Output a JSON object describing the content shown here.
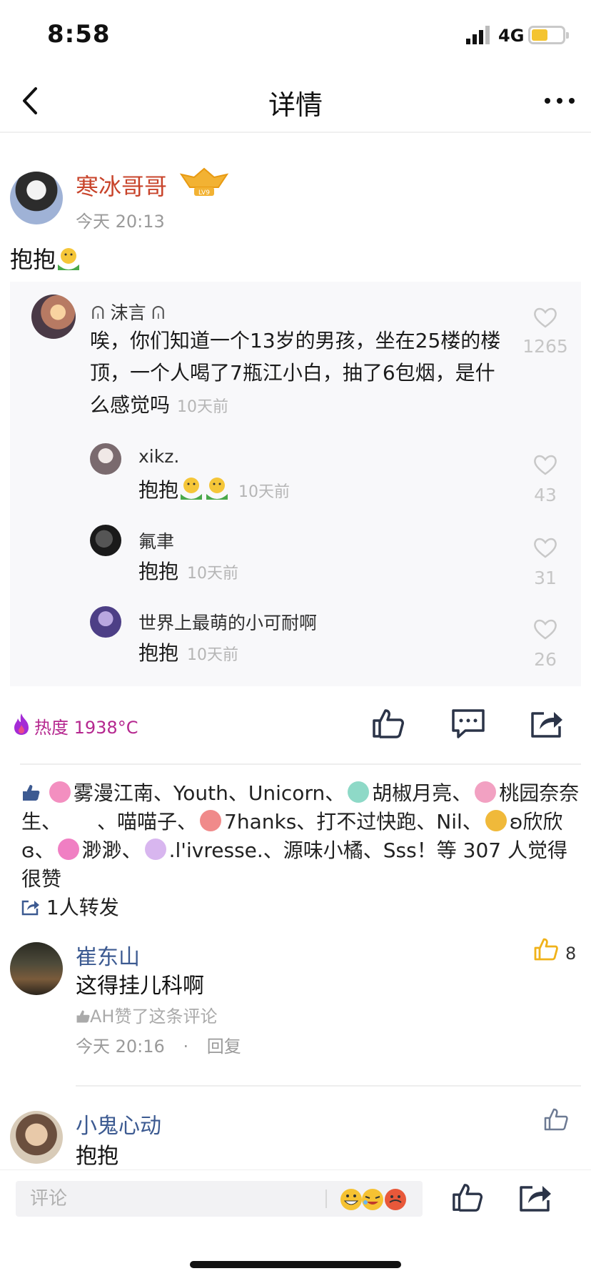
{
  "status_bar": {
    "time": "8:58",
    "network": "4G"
  },
  "nav": {
    "title": "详情"
  },
  "post": {
    "author": "寒冰哥哥",
    "level": "LV9",
    "time": "今天 20:13",
    "text": "抱抱"
  },
  "quoted": {
    "name": "沫言",
    "text": "唉，你们知道一个13岁的男孩，坐在25楼的楼顶，一个人喝了7瓶江小白，抽了6包烟，是什么感觉吗",
    "ago": "10天前",
    "likes": "1265",
    "replies": [
      {
        "name": "xikz.",
        "text": "抱抱",
        "ago": "10天前",
        "likes": "43"
      },
      {
        "name": "氟聿",
        "text": "抱抱",
        "ago": "10天前",
        "likes": "31"
      },
      {
        "name": "世界上最萌的小可耐啊",
        "text": "抱抱",
        "ago": "10天前",
        "likes": "26"
      }
    ]
  },
  "heat": {
    "label": "热度 1938°C"
  },
  "likers": {
    "p1": "雾漫江南、Youth、Unicorn、",
    "p2": "胡椒月亮、",
    "p3": "桃园奈奈生、",
    "p4": "、喵喵子、",
    "p5": "7hanks、打不过快跑、Nil、",
    "p6": "ʚ欣欣ɞ、",
    "p7": "渺渺、",
    "p8": ".l'ivresse.、源味小橘、Sss！等 307 人觉得很赞"
  },
  "forward": {
    "label": "1人转发"
  },
  "comments": [
    {
      "name": "崔东山",
      "text": "这得挂儿科啊",
      "liked_by": "AH赞了这条评论",
      "time": "今天 20:16",
      "reply": "回复",
      "likes": "8",
      "dot": "·"
    },
    {
      "name": "小鬼心动",
      "text": "抱抱"
    }
  ],
  "bottom": {
    "placeholder": "评论"
  },
  "colors": {
    "author_red": "#c8442b",
    "link_blue": "#3c5a91",
    "heat_purple": "#b5278f",
    "like_yellow": "#f4c430"
  }
}
